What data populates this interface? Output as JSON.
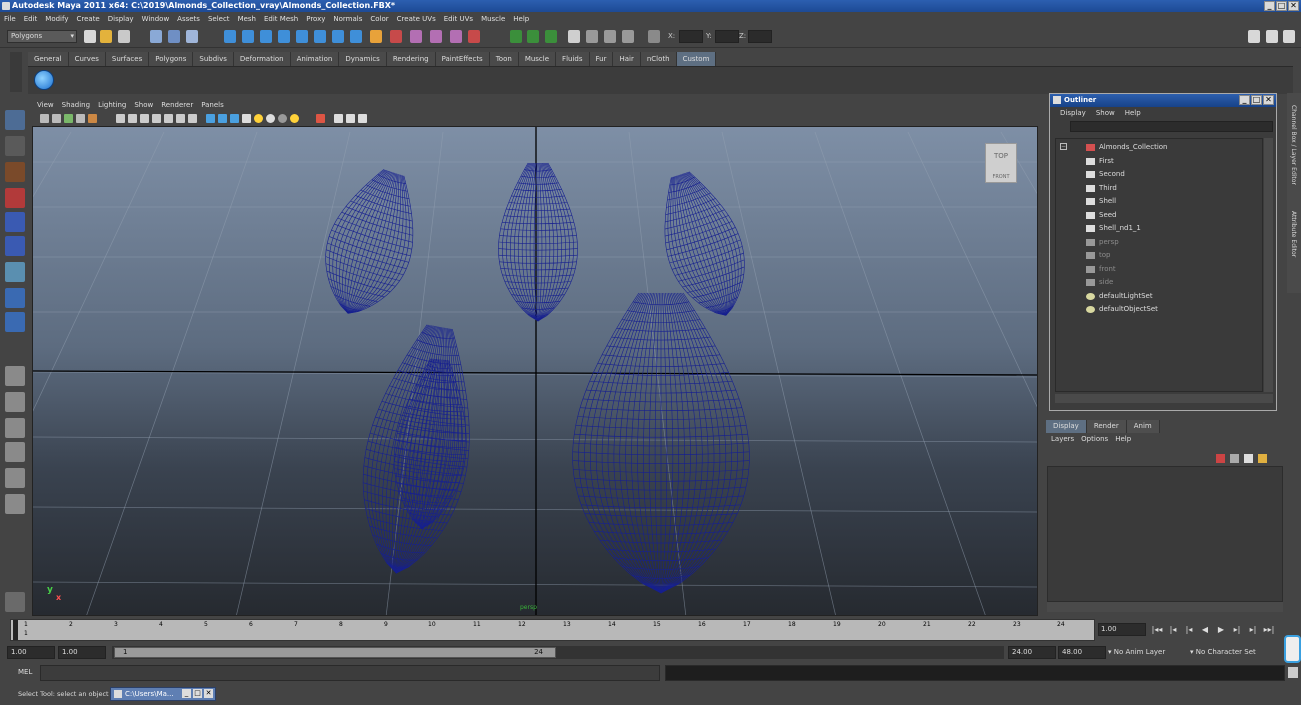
{
  "window": {
    "title": "Autodesk Maya 2011 x64: C:\\2019\\Almonds_Collection_vray\\Almonds_Collection.FBX*",
    "minimize": "_",
    "maximize": "□",
    "close": "✕"
  },
  "menubar": [
    "File",
    "Edit",
    "Modify",
    "Create",
    "Display",
    "Window",
    "Assets",
    "Select",
    "Mesh",
    "Edit Mesh",
    "Proxy",
    "Normals",
    "Color",
    "Create UVs",
    "Edit UVs",
    "Muscle",
    "Help"
  ],
  "statusline": {
    "mode": "Polygons",
    "x_label": "X:",
    "y_label": "Y:",
    "z_label": "Z:"
  },
  "shelf": {
    "tabs": [
      "General",
      "Curves",
      "Surfaces",
      "Polygons",
      "Subdivs",
      "Deformation",
      "Animation",
      "Dynamics",
      "Rendering",
      "PaintEffects",
      "Toon",
      "Muscle",
      "Fluids",
      "Fur",
      "Hair",
      "nCloth",
      "Custom"
    ],
    "active_tab": "Custom"
  },
  "viewport": {
    "menu": [
      "View",
      "Shading",
      "Lighting",
      "Show",
      "Renderer",
      "Panels"
    ],
    "camera": "persp",
    "viewcube_top": "TOP",
    "viewcube_front": "FRONT",
    "axis_y": "y",
    "axis_x": "x",
    "wire_color": "#17208f"
  },
  "outliner": {
    "title": "Outliner",
    "menu": [
      "Display",
      "Show",
      "Help"
    ],
    "items": [
      {
        "label": "Almonds_Collection",
        "level": 0,
        "dim": false
      },
      {
        "label": "First",
        "level": 1,
        "dim": false
      },
      {
        "label": "Second",
        "level": 1,
        "dim": false
      },
      {
        "label": "Third",
        "level": 1,
        "dim": false
      },
      {
        "label": "Shell",
        "level": 1,
        "dim": false
      },
      {
        "label": "Seed",
        "level": 1,
        "dim": false
      },
      {
        "label": "Shell_nd1_1",
        "level": 1,
        "dim": false
      },
      {
        "label": "persp",
        "level": 0,
        "dim": true
      },
      {
        "label": "top",
        "level": 0,
        "dim": true
      },
      {
        "label": "front",
        "level": 0,
        "dim": true
      },
      {
        "label": "side",
        "level": 0,
        "dim": true
      },
      {
        "label": "defaultLightSet",
        "level": 0,
        "dim": false
      },
      {
        "label": "defaultObjectSet",
        "level": 0,
        "dim": false
      }
    ]
  },
  "side_tabs": [
    "Channel Box / Layer Editor",
    "Attribute Editor"
  ],
  "layer_editor": {
    "tabs": [
      "Display",
      "Render",
      "Anim"
    ],
    "active_tab": "Display",
    "menu": [
      "Layers",
      "Options",
      "Help"
    ]
  },
  "timeslider": {
    "ticks": [
      "1",
      "2",
      "3",
      "4",
      "5",
      "6",
      "7",
      "8",
      "9",
      "10",
      "11",
      "12",
      "13",
      "14",
      "15",
      "16",
      "17",
      "18",
      "19",
      "20",
      "21",
      "22",
      "23",
      "24"
    ],
    "current_frame": "1.00",
    "playhead_label": "1"
  },
  "range": {
    "start": "1.00",
    "inner_start": "1.00",
    "knob_start": "1",
    "knob_end": "24",
    "end": "24.00",
    "outer_end": "48.00",
    "anim_layer": "No Anim Layer",
    "character_set": "No Character Set"
  },
  "cmdline": {
    "label": "MEL"
  },
  "helpline": {
    "text": "Select Tool: select an object",
    "task": "C:\\Users\\Ma..."
  }
}
